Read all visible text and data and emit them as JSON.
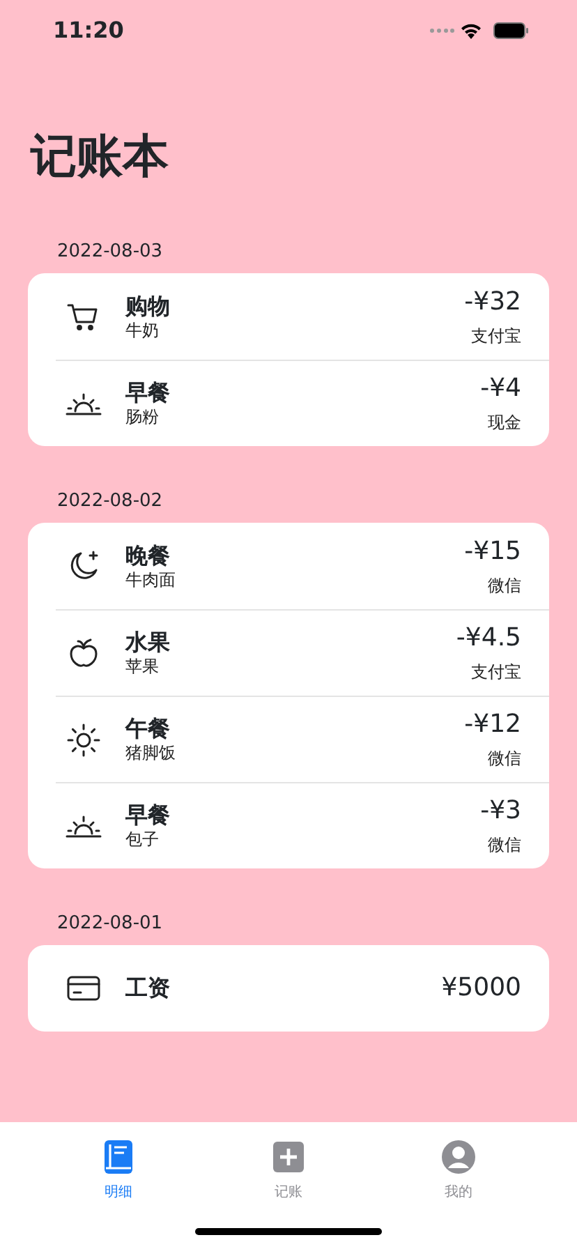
{
  "status_bar": {
    "time": "11:20"
  },
  "title": "记账本",
  "days": [
    {
      "date": "2022-08-03",
      "entries": [
        {
          "kind": "cart",
          "title": "购物",
          "note": "牛奶",
          "amount": "-¥32",
          "account": "支付宝"
        },
        {
          "kind": "sunrise",
          "title": "早餐",
          "note": "肠粉",
          "amount": "-¥4",
          "account": "现金"
        }
      ]
    },
    {
      "date": "2022-08-02",
      "entries": [
        {
          "kind": "moon",
          "title": "晚餐",
          "note": "牛肉面",
          "amount": "-¥15",
          "account": "微信"
        },
        {
          "kind": "fruit",
          "title": "水果",
          "note": "苹果",
          "amount": "-¥4.5",
          "account": "支付宝"
        },
        {
          "kind": "sun",
          "title": "午餐",
          "note": "猪脚饭",
          "amount": "-¥12",
          "account": "微信"
        },
        {
          "kind": "sunrise",
          "title": "早餐",
          "note": "包子",
          "amount": "-¥3",
          "account": "微信"
        }
      ]
    },
    {
      "date": "2022-08-01",
      "entries": [
        {
          "kind": "card",
          "title": "工资",
          "amount": "¥5000"
        }
      ]
    }
  ],
  "tab_bar": [
    {
      "kind": "book",
      "label": "明细",
      "selected": true
    },
    {
      "kind": "plus",
      "label": "记账",
      "selected": false
    },
    {
      "kind": "person",
      "label": "我的",
      "selected": false
    }
  ]
}
